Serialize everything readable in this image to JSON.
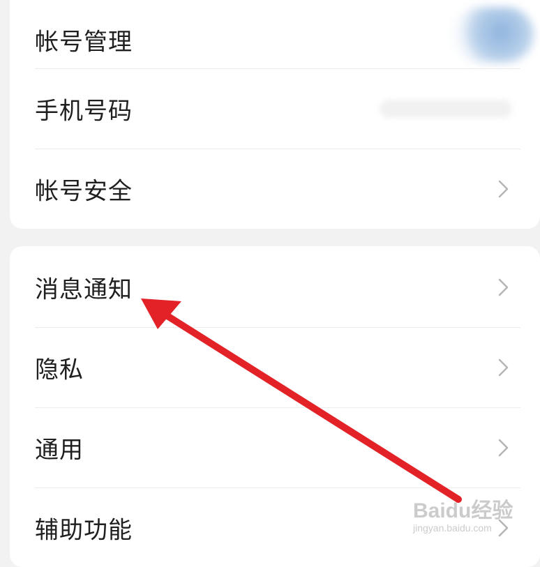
{
  "account_section": {
    "items": [
      {
        "label": "帐号管理",
        "has_chevron": false
      },
      {
        "label": "手机号码",
        "has_chevron": false
      },
      {
        "label": "帐号安全",
        "has_chevron": true
      }
    ]
  },
  "settings_section": {
    "items": [
      {
        "label": "消息通知",
        "has_chevron": true
      },
      {
        "label": "隐私",
        "has_chevron": true
      },
      {
        "label": "通用",
        "has_chevron": true
      },
      {
        "label": "辅助功能",
        "has_chevron": true
      }
    ]
  },
  "icons": {
    "chevron": "chevron-right-icon"
  },
  "annotation": {
    "arrow_color": "#e32227"
  },
  "watermark": {
    "main": "Baidu经验",
    "sub": "jingyan.baidu.com"
  }
}
